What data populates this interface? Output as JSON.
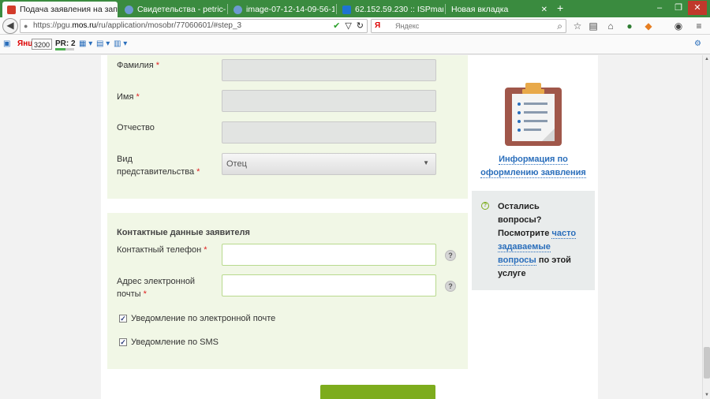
{
  "browser": {
    "tabs": [
      {
        "title": "Подача заявления на зап...",
        "active": true,
        "favicon_color": "#d23b2a"
      },
      {
        "title": "Свидетельства - petric-s@...",
        "active": false,
        "favicon_color": "#6d9ad1"
      },
      {
        "title": "image-07-12-14-09-56-1.jp...",
        "active": false,
        "favicon_color": "#6d9ad1"
      },
      {
        "title": "62.152.59.230 :: ISPmanage...",
        "active": false,
        "favicon_color": "#1e73d2"
      },
      {
        "title": "Новая вкладка",
        "active": false,
        "favicon_color": ""
      }
    ],
    "new_tab_glyph": "+",
    "window_controls": [
      "–",
      "❐",
      "✕"
    ],
    "url": {
      "prefix": "https://pgu.",
      "host": "mos.ru",
      "path": "/ru/application/mosobr/77060601/#step_3"
    },
    "search": {
      "engine": "Я",
      "placeholder": "Яндекс"
    },
    "toolbar": {
      "yandex_label": "Янц",
      "yandex_count": "3200",
      "pr_label": "PR: 2",
      "pr_level": 0.55
    }
  },
  "form": {
    "fields": [
      {
        "label": "Фамилия",
        "required": "*",
        "value": ""
      },
      {
        "label": "Имя",
        "required": "*",
        "value": ""
      },
      {
        "label": "Отчество",
        "required": "",
        "value": ""
      },
      {
        "label_line1": "Вид",
        "label_line2": "представительства",
        "required": "*",
        "value": "Отец"
      }
    ],
    "contact_section": {
      "title": "Контактные данные заявителя",
      "phone_label": "Контактный телефон",
      "phone_required": "*",
      "phone_value": "",
      "email_label_line1": "Адрес электронной",
      "email_label_line2": "почты",
      "email_required": "*",
      "email_value": "",
      "help_glyph": "?"
    },
    "checkboxes": [
      {
        "label": "Уведомление по электронной почте",
        "checked": true
      },
      {
        "label": "Уведомление по SMS",
        "checked": true
      }
    ],
    "checkmark_glyph": "✓"
  },
  "sidebar": {
    "info_link_line1": "Информация по",
    "info_link_line2": "оформлению заявления",
    "questions": {
      "line1": "Остались",
      "line2": "вопросы?",
      "line3": "Посмотрите ",
      "link1": "часто",
      "link2": "задаваемые",
      "link3": "вопросы",
      "tail": " по этой",
      "line_last": "услуге"
    }
  },
  "colors": {
    "tabbar": "#3a8b3f",
    "form_panel": "#f1f7e6",
    "accent_green": "#7dac1d",
    "link_blue": "#2a6ebb",
    "required_red": "#e02020"
  }
}
